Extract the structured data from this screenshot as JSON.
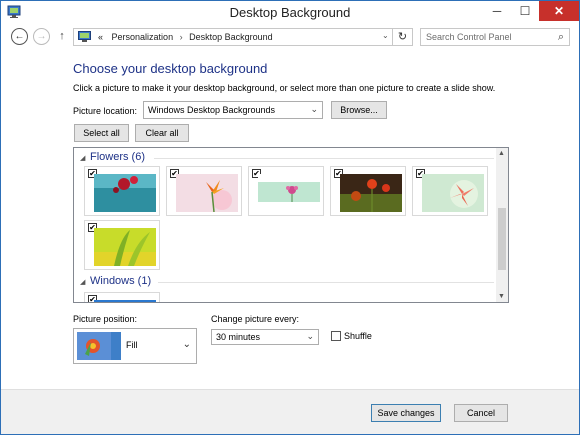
{
  "window": {
    "title": "Desktop Background"
  },
  "titlebar": {
    "minimize": "─",
    "maximize": "☐",
    "close": "✕"
  },
  "nav": {
    "back": "←",
    "forward": "→",
    "up": "↑"
  },
  "address": {
    "overflow": "«",
    "crumbs": [
      "Personalization",
      "Desktop Background"
    ],
    "separator": "›",
    "dropdown": "⌄",
    "refresh": "↻"
  },
  "search": {
    "placeholder": "Search Control Panel",
    "icon": "⌕"
  },
  "page": {
    "heading": "Choose your desktop background",
    "description": "Click a picture to make it your desktop background, or select more than one picture to create a slide show."
  },
  "picture_location": {
    "label": "Picture location:",
    "value": "Windows Desktop Backgrounds",
    "browse": "Browse..."
  },
  "buttons": {
    "select_all": "Select all",
    "clear_all": "Clear all"
  },
  "gallery": {
    "groups": [
      {
        "name": "Flowers (6)",
        "thumbnails": [
          {
            "checked": true,
            "icon": "flower-wallpaper"
          },
          {
            "checked": true,
            "icon": "flower-wallpaper"
          },
          {
            "checked": true,
            "icon": "flower-wallpaper"
          },
          {
            "checked": true,
            "icon": "flower-wallpaper"
          },
          {
            "checked": true,
            "icon": "flower-wallpaper"
          },
          {
            "checked": true,
            "icon": "leaf-wallpaper"
          }
        ]
      },
      {
        "name": "Windows (1)",
        "thumbnails": [
          {
            "checked": true,
            "icon": "windows-wallpaper"
          }
        ]
      }
    ],
    "check_mark": "✔",
    "collapse_glyph": "◢"
  },
  "picture_position": {
    "label": "Picture position:",
    "value": "Fill"
  },
  "change_picture": {
    "label": "Change picture every:",
    "value": "30 minutes"
  },
  "shuffle": {
    "label": "Shuffle",
    "checked": false
  },
  "footer": {
    "save": "Save changes",
    "cancel": "Cancel"
  },
  "colors": {
    "heading": "#1e3287",
    "close_button": "#c7302b",
    "window_border": "#2d6fb7"
  }
}
